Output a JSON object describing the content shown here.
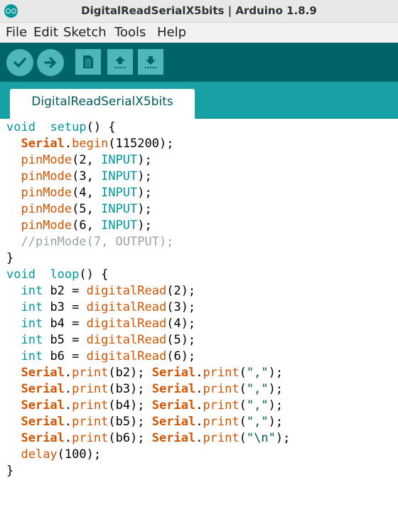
{
  "window": {
    "title": "DigitalReadSerialX5bits | Arduino 1.8.9",
    "app_icon": "arduino-logo-icon"
  },
  "menu": {
    "items": [
      "File",
      "Edit",
      "Sketch",
      "Tools",
      "Help"
    ]
  },
  "toolbar": {
    "buttons": [
      {
        "name": "verify",
        "icon": "check-icon"
      },
      {
        "name": "upload",
        "icon": "arrow-right-icon"
      },
      {
        "name": "new",
        "icon": "new-file-icon"
      },
      {
        "name": "open",
        "icon": "open-up-arrow-icon"
      },
      {
        "name": "save",
        "icon": "save-down-arrow-icon"
      }
    ]
  },
  "tabs": [
    {
      "label": "DigitalReadSerialX5bits",
      "active": true
    }
  ],
  "editor": {
    "lines": [
      [
        [
          "kw",
          "void"
        ],
        [
          "",
          "  "
        ],
        [
          "kw",
          "setup"
        ],
        [
          "",
          "() {"
        ]
      ],
      [
        [
          "",
          "  "
        ],
        [
          "bfn",
          "Serial"
        ],
        [
          "",
          "."
        ],
        [
          "fn",
          "begin"
        ],
        [
          "",
          "(115200);"
        ]
      ],
      [
        [
          "",
          "  "
        ],
        [
          "fn",
          "pinMode"
        ],
        [
          "",
          "(2, "
        ],
        [
          "kw",
          "INPUT"
        ],
        [
          "",
          ");"
        ]
      ],
      [
        [
          "",
          "  "
        ],
        [
          "fn",
          "pinMode"
        ],
        [
          "",
          "(3, "
        ],
        [
          "kw",
          "INPUT"
        ],
        [
          "",
          ");"
        ]
      ],
      [
        [
          "",
          "  "
        ],
        [
          "fn",
          "pinMode"
        ],
        [
          "",
          "(4, "
        ],
        [
          "kw",
          "INPUT"
        ],
        [
          "",
          ");"
        ]
      ],
      [
        [
          "",
          "  "
        ],
        [
          "fn",
          "pinMode"
        ],
        [
          "",
          "(5, "
        ],
        [
          "kw",
          "INPUT"
        ],
        [
          "",
          ");"
        ]
      ],
      [
        [
          "",
          "  "
        ],
        [
          "fn",
          "pinMode"
        ],
        [
          "",
          "(6, "
        ],
        [
          "kw",
          "INPUT"
        ],
        [
          "",
          ");"
        ]
      ],
      [
        [
          "",
          "  "
        ],
        [
          "cm",
          "//pinMode(7, OUTPUT);"
        ]
      ],
      [
        [
          "",
          "}"
        ]
      ],
      [
        [
          "kw",
          "void"
        ],
        [
          "",
          "  "
        ],
        [
          "kw",
          "loop"
        ],
        [
          "",
          "() {"
        ]
      ],
      [
        [
          "",
          "  "
        ],
        [
          "kw",
          "int"
        ],
        [
          "",
          " b2 = "
        ],
        [
          "fn",
          "digitalRead"
        ],
        [
          "",
          "(2);"
        ]
      ],
      [
        [
          "",
          "  "
        ],
        [
          "kw",
          "int"
        ],
        [
          "",
          " b3 = "
        ],
        [
          "fn",
          "digitalRead"
        ],
        [
          "",
          "(3);"
        ]
      ],
      [
        [
          "",
          "  "
        ],
        [
          "kw",
          "int"
        ],
        [
          "",
          " b4 = "
        ],
        [
          "fn",
          "digitalRead"
        ],
        [
          "",
          "(4);"
        ]
      ],
      [
        [
          "",
          "  "
        ],
        [
          "kw",
          "int"
        ],
        [
          "",
          " b5 = "
        ],
        [
          "fn",
          "digitalRead"
        ],
        [
          "",
          "(5);"
        ]
      ],
      [
        [
          "",
          "  "
        ],
        [
          "kw",
          "int"
        ],
        [
          "",
          " b6 = "
        ],
        [
          "fn",
          "digitalRead"
        ],
        [
          "",
          "(6);"
        ]
      ],
      [
        [
          "",
          "  "
        ],
        [
          "bfn",
          "Serial"
        ],
        [
          "",
          "."
        ],
        [
          "fn",
          "print"
        ],
        [
          "",
          "(b2); "
        ],
        [
          "bfn",
          "Serial"
        ],
        [
          "",
          "."
        ],
        [
          "fn",
          "print"
        ],
        [
          "",
          "("
        ],
        [
          "str",
          "\",\""
        ],
        [
          "",
          ");"
        ]
      ],
      [
        [
          "",
          "  "
        ],
        [
          "bfn",
          "Serial"
        ],
        [
          "",
          "."
        ],
        [
          "fn",
          "print"
        ],
        [
          "",
          "(b3); "
        ],
        [
          "bfn",
          "Serial"
        ],
        [
          "",
          "."
        ],
        [
          "fn",
          "print"
        ],
        [
          "",
          "("
        ],
        [
          "str",
          "\",\""
        ],
        [
          "",
          ");"
        ]
      ],
      [
        [
          "",
          "  "
        ],
        [
          "bfn",
          "Serial"
        ],
        [
          "",
          "."
        ],
        [
          "fn",
          "print"
        ],
        [
          "",
          "(b4); "
        ],
        [
          "bfn",
          "Serial"
        ],
        [
          "",
          "."
        ],
        [
          "fn",
          "print"
        ],
        [
          "",
          "("
        ],
        [
          "str",
          "\",\""
        ],
        [
          "",
          ");"
        ]
      ],
      [
        [
          "",
          "  "
        ],
        [
          "bfn",
          "Serial"
        ],
        [
          "",
          "."
        ],
        [
          "fn",
          "print"
        ],
        [
          "",
          "(b5); "
        ],
        [
          "bfn",
          "Serial"
        ],
        [
          "",
          "."
        ],
        [
          "fn",
          "print"
        ],
        [
          "",
          "("
        ],
        [
          "str",
          "\",\""
        ],
        [
          "",
          ");"
        ]
      ],
      [
        [
          "",
          "  "
        ],
        [
          "bfn",
          "Serial"
        ],
        [
          "",
          "."
        ],
        [
          "fn",
          "print"
        ],
        [
          "",
          "(b6); "
        ],
        [
          "bfn",
          "Serial"
        ],
        [
          "",
          "."
        ],
        [
          "fn",
          "print"
        ],
        [
          "",
          "("
        ],
        [
          "str",
          "\"\\n\""
        ],
        [
          "",
          ");"
        ]
      ],
      [
        [
          "",
          "  "
        ],
        [
          "fn",
          "delay"
        ],
        [
          "",
          "(100);"
        ]
      ],
      [
        [
          "",
          "}"
        ]
      ]
    ]
  }
}
